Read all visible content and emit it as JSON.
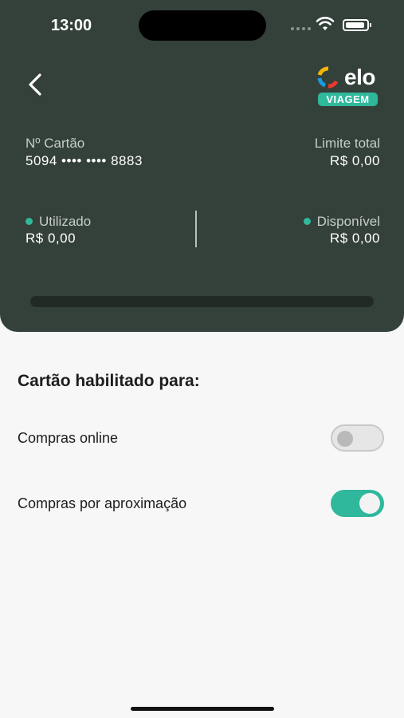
{
  "status_bar": {
    "time": "13:00"
  },
  "brand": {
    "name": "elo",
    "tag": "VIAGEM"
  },
  "card": {
    "number_label": "Nº Cartão",
    "number_value": "5094 •••• •••• 8883",
    "limit_label": "Limite total",
    "limit_value": "R$ 0,00",
    "used_label": "Utilizado",
    "used_value": "R$ 0,00",
    "available_label": "Disponível",
    "available_value": "R$ 0,00",
    "usage_fraction": 0
  },
  "settings": {
    "title": "Cartão habilitado para:",
    "options": [
      {
        "label": "Compras online",
        "enabled": false
      },
      {
        "label": "Compras por aproximação",
        "enabled": true
      }
    ]
  },
  "colors": {
    "header": "#34403a",
    "accent": "#2fb89c"
  }
}
